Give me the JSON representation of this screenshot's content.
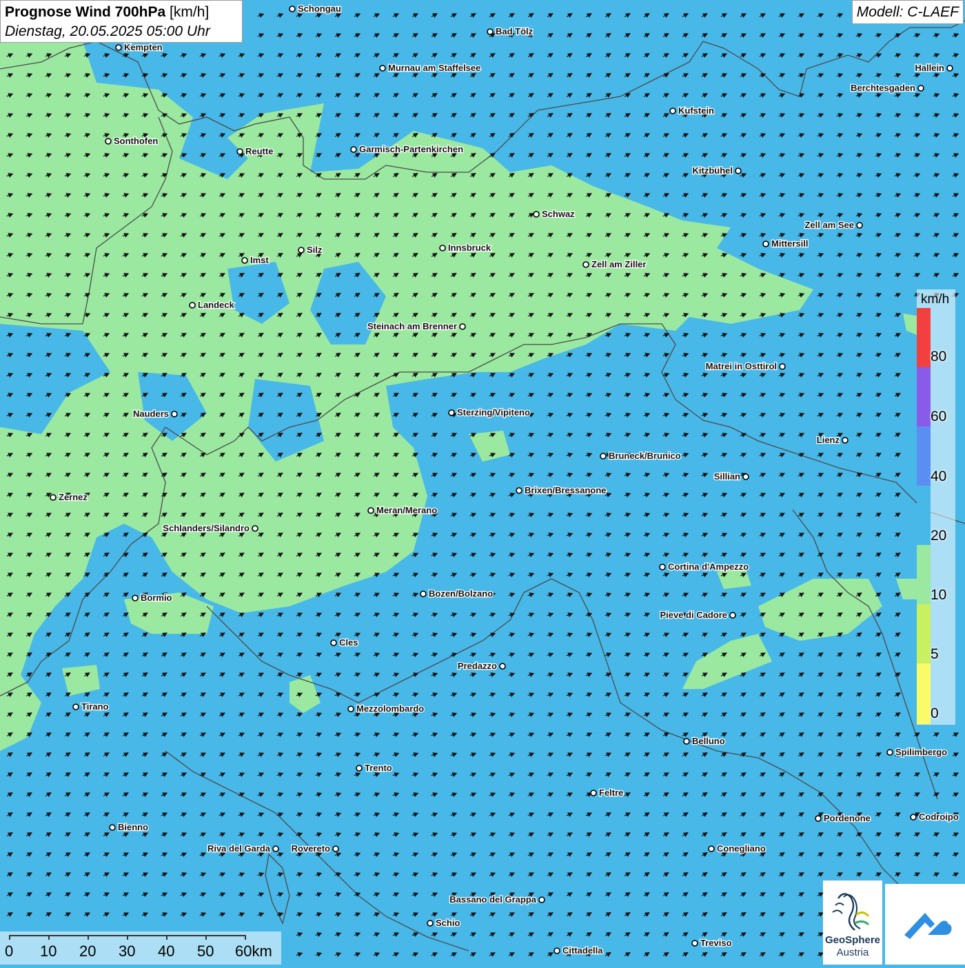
{
  "title": {
    "main": "Prognose Wind 700hPa",
    "unit": "[km/h]",
    "datetime": "Dienstag, 20.05.2025 05:00 Uhr"
  },
  "model_label": "Modell: C-LAEF",
  "colors": {
    "wind_0_5": "#fbfb6a",
    "wind_5_10": "#c8f060",
    "wind_10_20": "#9be9a0",
    "wind_20_40": "#48b8e8",
    "wind_40_60": "#5a8ef0",
    "wind_60_80": "#8a5ae8",
    "wind_80_plus": "#f24040",
    "arrow": "#111111",
    "border": "#4a4a4a"
  },
  "legend": {
    "unit": "km/h",
    "ticks": [
      "80",
      "60",
      "40",
      "20",
      "10",
      "5",
      "0"
    ]
  },
  "wind_direction": "southwest",
  "places": [
    {
      "name": "Schongau"
    },
    {
      "name": "Bad Tölz"
    },
    {
      "name": "Kempten"
    },
    {
      "name": "Murnau am Staffelsee"
    },
    {
      "name": "Hallein"
    },
    {
      "name": "Berchtesgaden"
    },
    {
      "name": "Kufstein"
    },
    {
      "name": "Sonthofen"
    },
    {
      "name": "Reutte"
    },
    {
      "name": "Garmisch-Partenkirchen"
    },
    {
      "name": "Kitzbühel"
    },
    {
      "name": "Schwaz"
    },
    {
      "name": "Zell am See"
    },
    {
      "name": "Mittersill"
    },
    {
      "name": "Silz"
    },
    {
      "name": "Innsbruck"
    },
    {
      "name": "Imst"
    },
    {
      "name": "Zell am Ziller"
    },
    {
      "name": "Landeck"
    },
    {
      "name": "Steinach am Brenner"
    },
    {
      "name": "Matrei in Osttirol"
    },
    {
      "name": "Nauders"
    },
    {
      "name": "Sterzing/Vipiteno"
    },
    {
      "name": "Lienz"
    },
    {
      "name": "Bruneck/Brunico"
    },
    {
      "name": "Sillian"
    },
    {
      "name": "Zernez"
    },
    {
      "name": "Brixen/Bressanone"
    },
    {
      "name": "Meran/Merano"
    },
    {
      "name": "Schlanders/Silandro"
    },
    {
      "name": "Cortina d'Ampezzo"
    },
    {
      "name": "Bormio"
    },
    {
      "name": "Bozen/Bolzano"
    },
    {
      "name": "Pieve di Cadore"
    },
    {
      "name": "Cles"
    },
    {
      "name": "Predazzo"
    },
    {
      "name": "Tirano"
    },
    {
      "name": "Mezzolombardo"
    },
    {
      "name": "Belluno"
    },
    {
      "name": "Spilimbergo"
    },
    {
      "name": "Trento"
    },
    {
      "name": "Feltre"
    },
    {
      "name": "Bienno"
    },
    {
      "name": "Pordenone"
    },
    {
      "name": "Codroipo"
    },
    {
      "name": "Riva del Garda"
    },
    {
      "name": "Rovereto"
    },
    {
      "name": "Conegliano"
    },
    {
      "name": "Bassano del Grappa"
    },
    {
      "name": "Schio"
    },
    {
      "name": "Treviso"
    },
    {
      "name": "Cittadella"
    }
  ],
  "scale": {
    "ticks": [
      "0",
      "10",
      "20",
      "30",
      "40",
      "50",
      "60km"
    ]
  },
  "logos": {
    "geosphere_name": "GeoSphere",
    "geosphere_country": "Austria"
  }
}
